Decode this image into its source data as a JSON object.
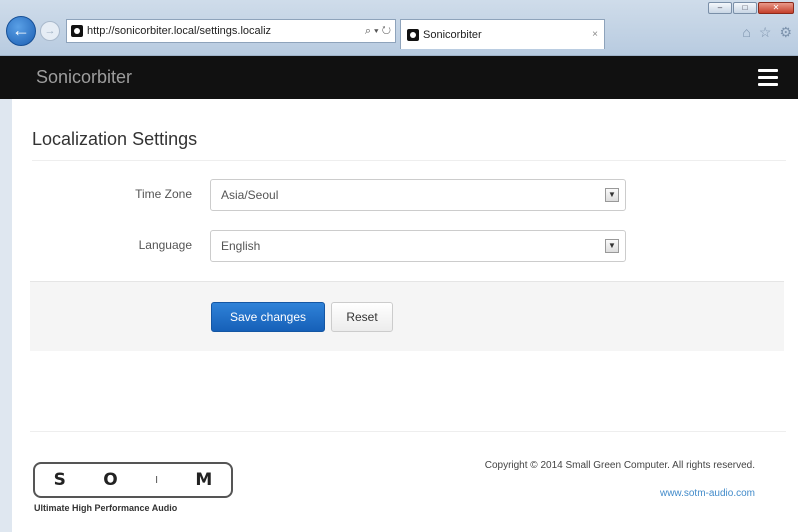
{
  "browser": {
    "url": "http://sonicorbiter.local/settings.localiz",
    "address_tools": "⌕ ▾ ↻",
    "tab_title": "Sonicorbiter",
    "tab_close": "×",
    "window_controls": [
      "–",
      "□",
      "✕"
    ],
    "right_icons": [
      "home-icon",
      "star-icon",
      "gear-icon"
    ]
  },
  "navbar": {
    "brand": "Sonicorbiter"
  },
  "main": {
    "title": "Localization Settings",
    "fields": [
      {
        "label": "Time Zone",
        "value": "Asia/Seoul"
      },
      {
        "label": "Language",
        "value": "English"
      }
    ],
    "save_label": "Save changes",
    "reset_label": "Reset"
  },
  "footer": {
    "logo_letters": [
      "S",
      "O",
      "I",
      "M"
    ],
    "tagline": "Ultimate High Performance Audio",
    "copyright": "Copyright © 2014 Small Green Computer. All rights reserved.",
    "link": "www.sotm-audio.com"
  },
  "colors": {
    "primary": "#1660b8",
    "navbar": "#111111",
    "link": "#428bca"
  }
}
